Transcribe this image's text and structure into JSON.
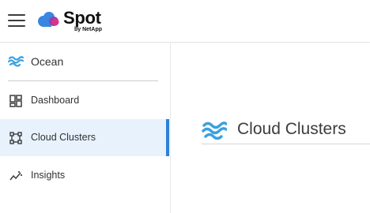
{
  "brand": {
    "name": "Spot",
    "byline": "by NetApp",
    "colors": {
      "cloud_blue": "#3a86e0",
      "cloud_purple": "#8e44ad",
      "cloud_pink": "#e0308a"
    }
  },
  "header": {
    "menu_icon": "hamburger-menu-icon"
  },
  "sidebar": {
    "section": {
      "label": "Ocean",
      "icon": "ocean-wave-icon"
    },
    "items": [
      {
        "label": "Dashboard",
        "icon": "dashboard-grid-icon",
        "active": false
      },
      {
        "label": "Cloud Clusters",
        "icon": "cluster-nodes-icon",
        "active": true
      },
      {
        "label": "Insights",
        "icon": "insights-trend-icon",
        "active": false
      }
    ],
    "active_color": "#2f80d8",
    "active_bg": "#e8f2fc"
  },
  "main": {
    "title": "Cloud Clusters",
    "title_icon": "ocean-wave-icon"
  }
}
